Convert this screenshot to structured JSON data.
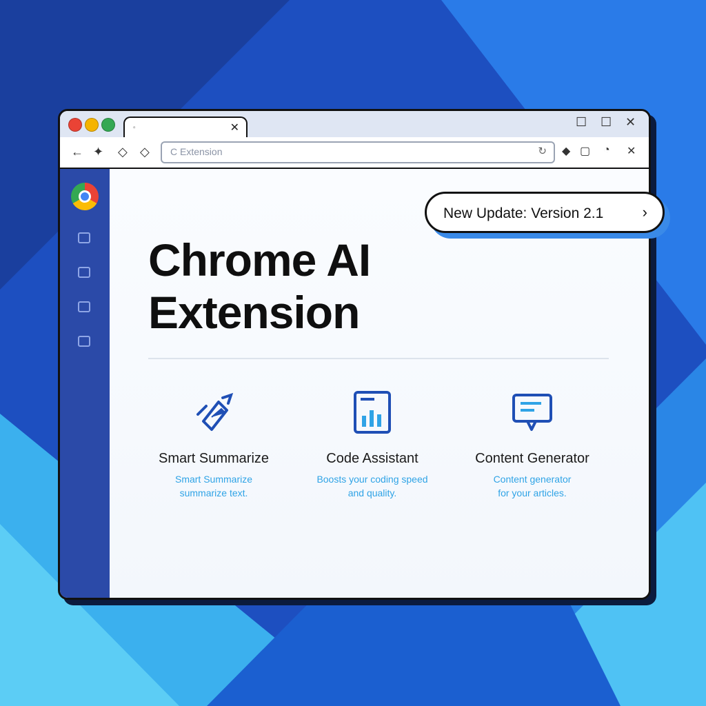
{
  "colors": {
    "background": "#1c56c4",
    "sidebar": "#2b4aa8",
    "accent": "#2fa3e6",
    "pill_shadow": "#3a8ae8",
    "traffic_red": "#ea4335",
    "traffic_yellow": "#f5b400",
    "traffic_green": "#34a853"
  },
  "browser": {
    "tab": {
      "favicon": "▫",
      "close": "✕"
    },
    "window_controls": {
      "minimize": "☐",
      "maximize": "☐",
      "close": "✕"
    },
    "toolbar": {
      "back": "←",
      "forward": "✦",
      "home": "◇",
      "reload": "◇",
      "omnibox_text": "C Extension",
      "omnibox_reload": "↻",
      "icons": [
        "◆",
        "▢",
        "◔",
        "✕"
      ]
    }
  },
  "sidebar": {
    "icons": [
      "folder-icon",
      "table-icon",
      "clipboard-icon",
      "save-icon"
    ]
  },
  "main": {
    "title_line1": "Chrome AI",
    "title_line2": "Extension",
    "features": [
      {
        "icon": "summarize-icon",
        "name": "Smart Summarize",
        "desc_line1": "Smart Summarize",
        "desc_line2": "summarize text."
      },
      {
        "icon": "chart-icon",
        "name": "Code Assistant",
        "desc_line1": "Boosts your coding speed",
        "desc_line2": "and quality."
      },
      {
        "icon": "chat-icon",
        "name": "Content Generator",
        "desc_line1": "Content generator",
        "desc_line2": "for your articles."
      }
    ]
  },
  "update": {
    "label": "New Update: Version 2.1",
    "chevron": "›"
  }
}
